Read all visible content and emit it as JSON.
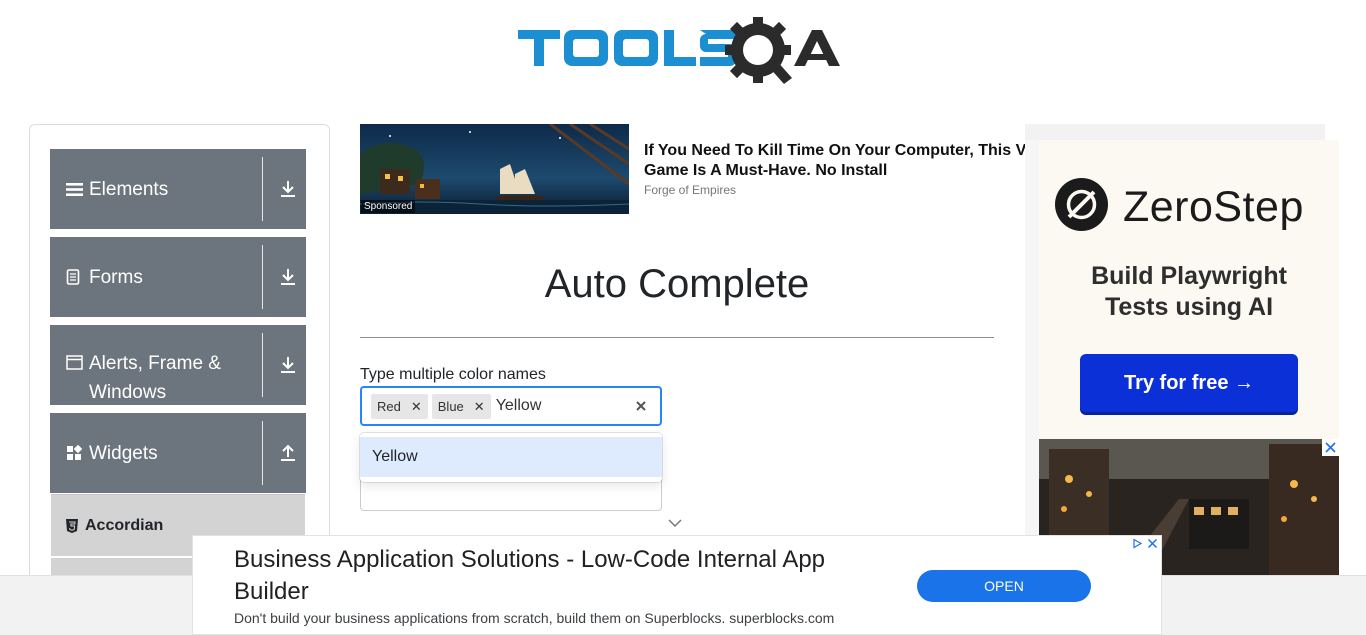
{
  "logo": {
    "text": "TOOLSQA",
    "icon": "toolsqa-logo"
  },
  "sidebar": {
    "groups": [
      {
        "label": "Elements",
        "icon": "hamburger-icon",
        "arrow": "download-arrow-icon"
      },
      {
        "label": "Forms",
        "icon": "document-icon",
        "arrow": "download-arrow-icon"
      },
      {
        "label_line1": "Alerts, Frame &",
        "label_line2": "Windows",
        "icon": "window-icon",
        "arrow": "download-arrow-icon"
      },
      {
        "label": "Widgets",
        "icon": "widgets-icon",
        "arrow": "upload-arrow-icon"
      }
    ],
    "subitems": [
      {
        "label": "Accordian",
        "icon": "html5-icon"
      }
    ]
  },
  "top_ad": {
    "sponsored": "Sponsored",
    "title_line1": "If You Need To Kill Time On Your Computer, This V",
    "title_line2": "Game Is A Must-Have. No Install",
    "source": "Forge of Empires"
  },
  "main": {
    "title": "Auto Complete",
    "multi_label": "Type multiple color names",
    "chips": [
      "Red",
      "Blue"
    ],
    "typed_value": "Yellow",
    "suggestions": [
      "Yellow"
    ],
    "single_value": ""
  },
  "right_ad": {
    "brand": "ZeroStep",
    "tagline_line1": "Build Playwright",
    "tagline_line2": "Tests using AI",
    "cta": "Try for free →",
    "brand_color": "#0b30d8"
  },
  "bottom_ad": {
    "title": "Business Application Solutions - Low-Code Internal App Builder",
    "description": "Don't build your business applications from scratch, build them on Superblocks. superblocks.com",
    "cta": "OPEN",
    "cta_color": "#1a73e8"
  }
}
